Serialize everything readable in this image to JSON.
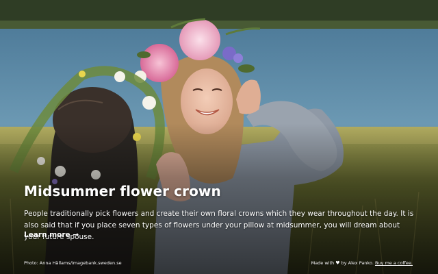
{
  "hero": {
    "title": "Midsummer flower crown",
    "description": "People traditionally pick flowers and create their own floral crowns which they wear throughout the day. It is also said that if you place seven types of flowers under your pillow at midsummer, you will dream about your future spouse.",
    "learn_more": "Learn more →"
  },
  "footer": {
    "photo_credit": "Photo: Anna Hällams/imagebank.sweden.se",
    "made_with": "Made with",
    "heart_icon": "heart-icon",
    "by_author": "by Alex Panko.",
    "coffee_link": "Buy me a coffee."
  },
  "colors": {
    "text": "#ffffff",
    "lake": "#5a8aa8",
    "forest": "#2c3a22",
    "meadow": "#8a8a3c"
  }
}
